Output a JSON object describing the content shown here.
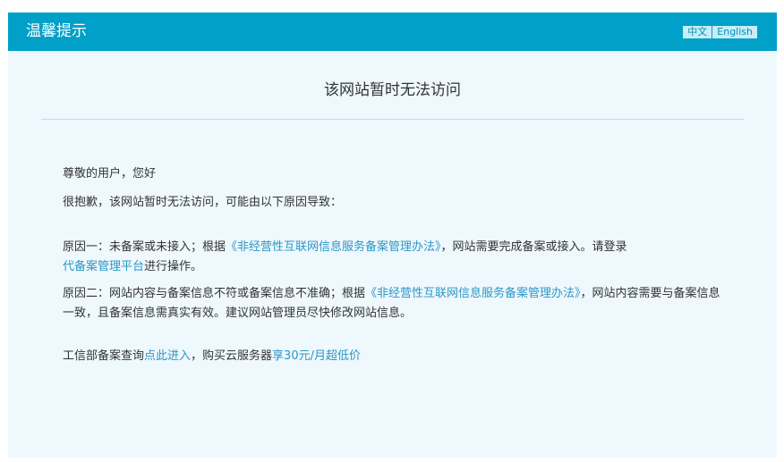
{
  "header": {
    "title": "温馨提示",
    "lang_zh": "中文",
    "lang_en": "English"
  },
  "main": {
    "title": "该网站暂时无法访问",
    "greeting": "尊敬的用户，您好",
    "intro": "很抱歉，该网站暂时无法访问，可能由以下原因导致：",
    "reason1": {
      "prefix": "原因一：未备案或未接入；根据",
      "law_link": "《非经营性互联网信息服务备案管理办法》",
      "middle": "，网站需要完成备案或接入。请登录",
      "platform_link": "代备案管理平台",
      "suffix": "进行操作。"
    },
    "reason2": {
      "prefix": "原因二：网站内容与备案信息不符或备案信息不准确；根据",
      "law_link": "《非经营性互联网信息服务备案管理办法》",
      "suffix": "，网站内容需要与备案信息一致，且备案信息需真实有效。建议网站管理员尽快修改网站信息。"
    },
    "footer": {
      "prefix": "工信部备案查询",
      "query_link": "点此进入",
      "middle": "，购买云服务器",
      "promo_link": "享30元/月超低价"
    }
  },
  "colors": {
    "header_bg": "#00a0c8",
    "panel_bg": "#eef8fd",
    "link": "#2d97c5",
    "text": "#333333"
  }
}
